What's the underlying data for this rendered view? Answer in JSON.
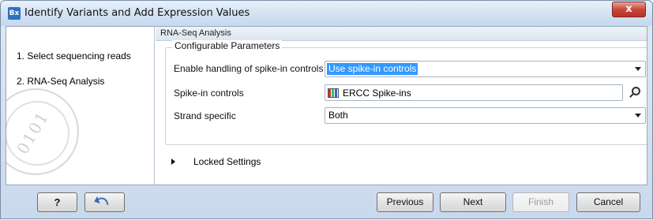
{
  "window": {
    "title": "Identify Variants and Add Expression Values",
    "app_icon": "Bx",
    "close_glyph": "x"
  },
  "steps": [
    {
      "label": "1.  Select sequencing reads"
    },
    {
      "label": "2.  RNA-Seq Analysis"
    }
  ],
  "panel": {
    "header": "RNA-Seq Analysis",
    "group_title": "Configurable Parameters",
    "rows": {
      "spike_handling": {
        "label": "Enable handling of spike-in controls",
        "value": "Use spike-in controls"
      },
      "spike_controls": {
        "label": "Spike-in controls",
        "value": "ERCC Spike-ins"
      },
      "strand": {
        "label": "Strand specific",
        "value": "Both"
      }
    },
    "locked_label": "Locked Settings"
  },
  "footer": {
    "help_label": "?",
    "previous_label": "Previous",
    "next_label": "Next",
    "finish_label": "Finish",
    "cancel_label": "Cancel"
  },
  "colors": {
    "selection": "#3399ff",
    "close_button": "#c9473a"
  }
}
